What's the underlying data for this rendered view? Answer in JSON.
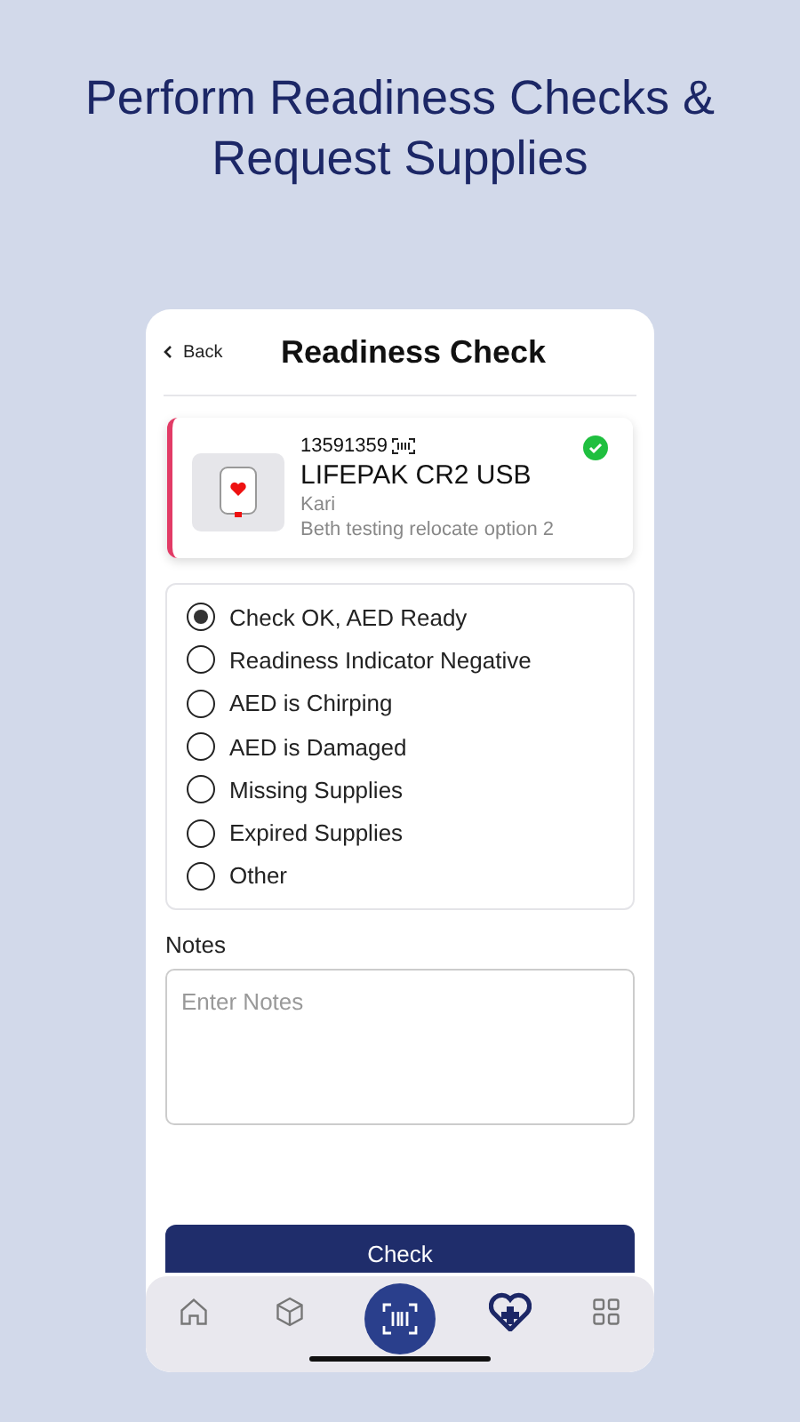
{
  "headline": "Perform Readiness Checks & Request Supplies",
  "header": {
    "back": "Back",
    "title": "Readiness Check"
  },
  "device": {
    "serial": "13591359",
    "name": "LIFEPAK CR2 USB",
    "owner": "Kari",
    "location": "Beth testing relocate option 2",
    "ok": true
  },
  "options": [
    {
      "label": "Check OK, AED Ready",
      "selected": true
    },
    {
      "label": "Readiness Indicator Negative",
      "selected": false
    },
    {
      "label": "AED is Chirping",
      "selected": false
    },
    {
      "label": "AED is Damaged",
      "selected": false
    },
    {
      "label": "Missing Supplies",
      "selected": false
    },
    {
      "label": "Expired Supplies",
      "selected": false
    },
    {
      "label": "Other",
      "selected": false
    }
  ],
  "notes": {
    "label": "Notes",
    "placeholder": "Enter Notes"
  },
  "submit": "Check",
  "tabs": [
    {
      "kind": "home",
      "selected": false
    },
    {
      "kind": "box",
      "selected": false
    },
    {
      "kind": "scan",
      "selected": false
    },
    {
      "kind": "heart",
      "selected": true
    },
    {
      "kind": "grid",
      "selected": false
    }
  ]
}
